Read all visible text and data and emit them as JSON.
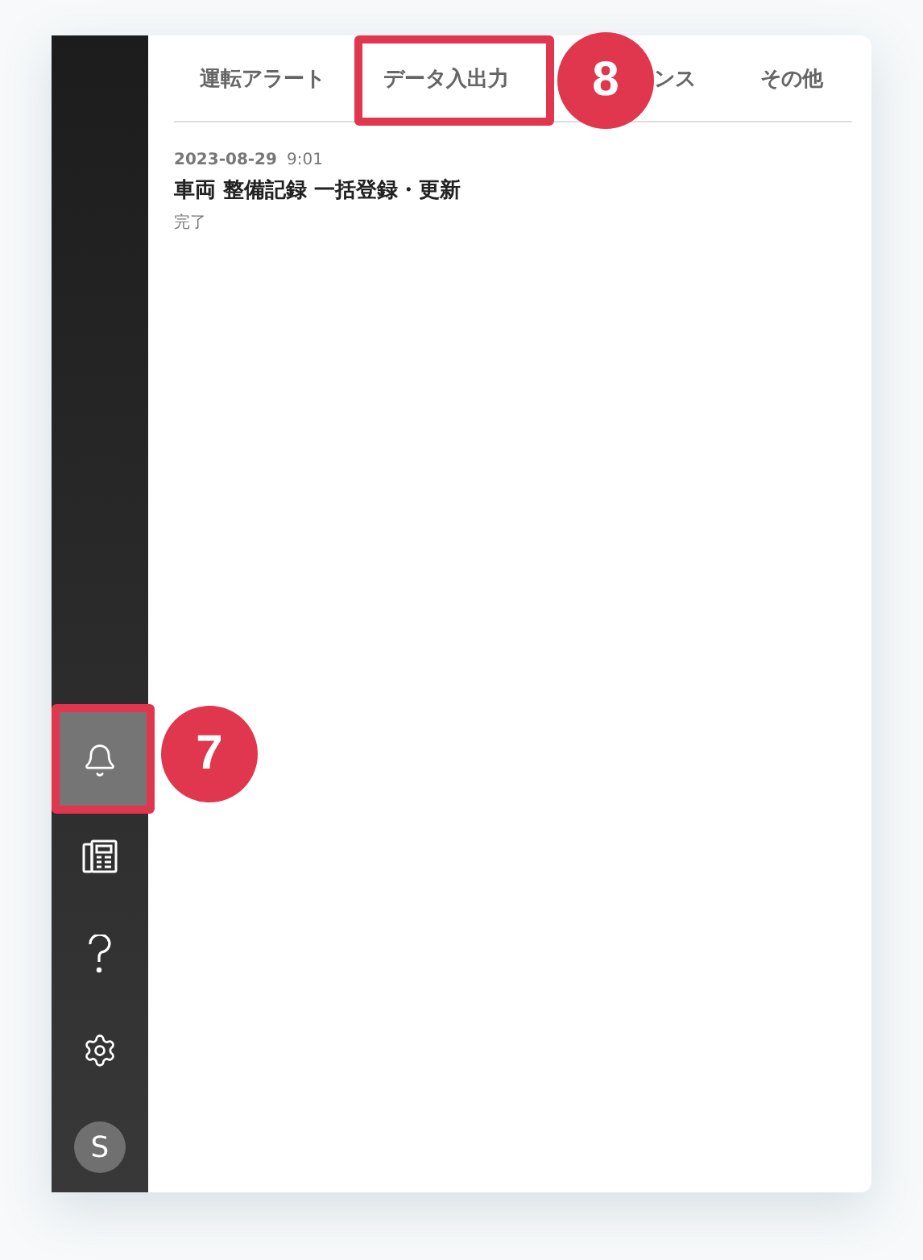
{
  "sidebar": {
    "items": [
      {
        "kind": "bell",
        "selected": true
      },
      {
        "kind": "fax",
        "selected": false
      },
      {
        "kind": "help",
        "selected": false
      },
      {
        "kind": "settings",
        "selected": false
      }
    ],
    "avatar": "S"
  },
  "tabs": [
    {
      "label": "運転アラート"
    },
    {
      "label": "データ入出力"
    },
    {
      "label": "ンス"
    },
    {
      "label": "その他"
    }
  ],
  "notifications": [
    {
      "date": "2023-08-29",
      "time": "9:01",
      "title": "車両 整備記録 一括登録・更新",
      "status": "完了"
    }
  ],
  "callouts": [
    {
      "number": "8"
    },
    {
      "number": "7"
    }
  ]
}
